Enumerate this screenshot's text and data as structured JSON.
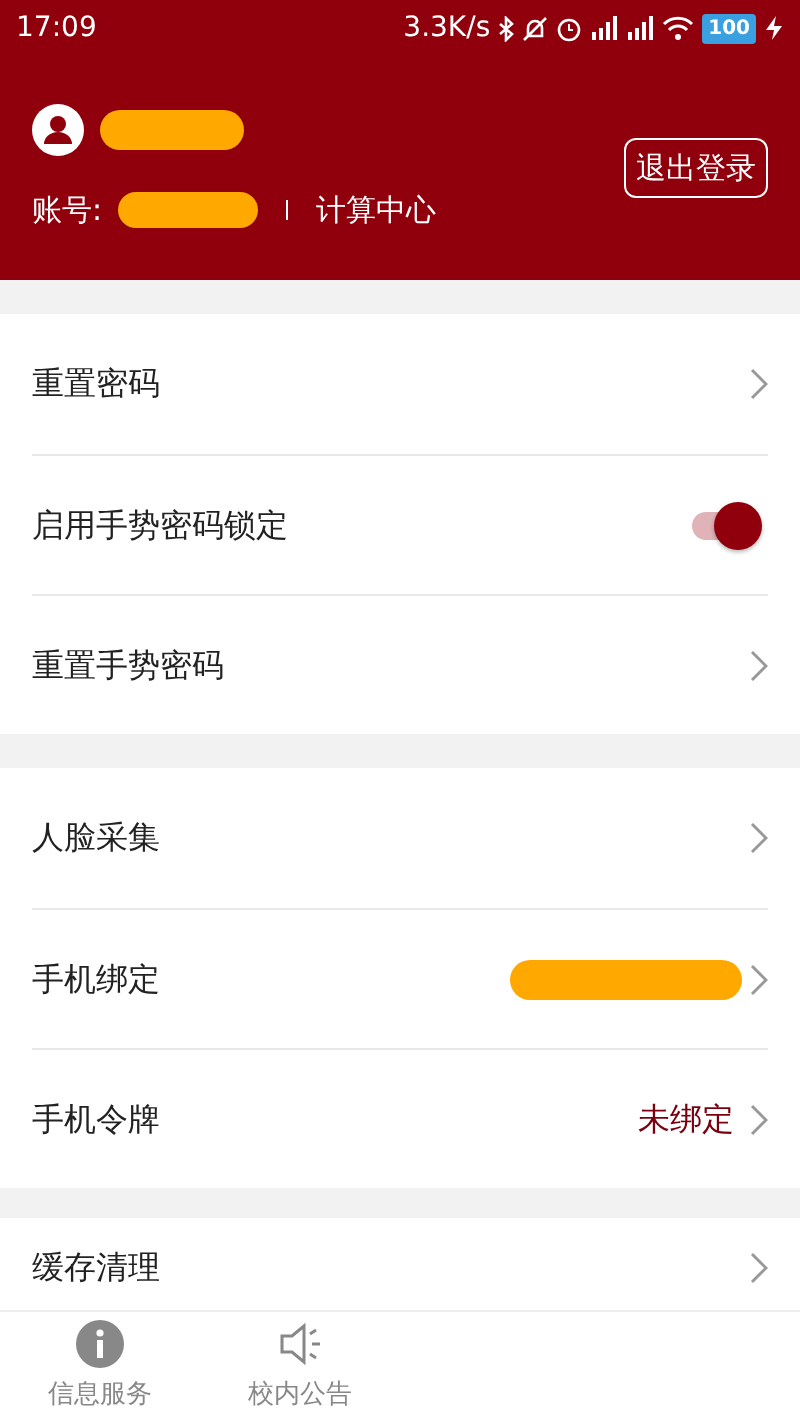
{
  "status_bar": {
    "time": "17:09",
    "speed": "3.3K/s",
    "battery": "100"
  },
  "header": {
    "name_redacted": true,
    "account_label": "账号:",
    "account_redacted": true,
    "department": "计算中心",
    "logout_button": "退出登录"
  },
  "sections": [
    {
      "rows": [
        {
          "kind": "link",
          "label": "重置密码"
        },
        {
          "kind": "toggle",
          "label": "启用手势密码锁定",
          "on": true
        },
        {
          "kind": "link",
          "label": "重置手势密码"
        }
      ]
    },
    {
      "rows": [
        {
          "kind": "link",
          "label": "人脸采集"
        },
        {
          "kind": "link",
          "label": "手机绑定",
          "redacted": true
        },
        {
          "kind": "link",
          "label": "手机令牌",
          "value": "未绑定"
        }
      ]
    },
    {
      "rows": [
        {
          "kind": "link",
          "label": "缓存清理"
        }
      ]
    }
  ],
  "bottom_nav": [
    {
      "kind": "info",
      "label": "信息服务"
    },
    {
      "kind": "speaker",
      "label": "校内公告"
    }
  ]
}
